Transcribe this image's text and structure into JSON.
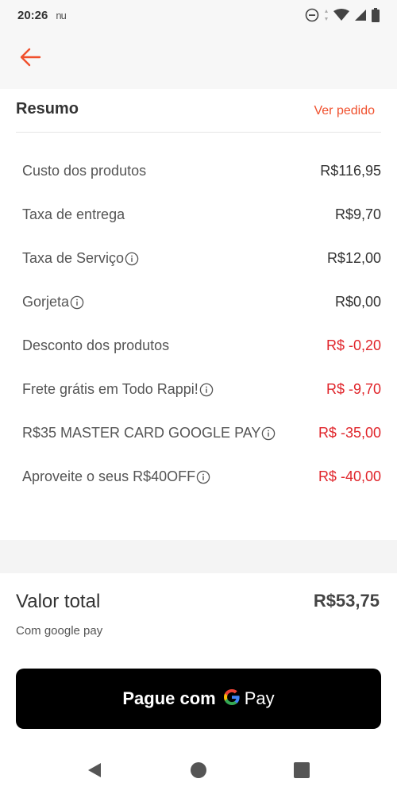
{
  "status_bar": {
    "time": "20:26",
    "app_indicator": "nu"
  },
  "icons": {
    "back": "arrow-left-icon",
    "info": "info-icon",
    "dnd": "do-not-disturb-icon",
    "wifi": "wifi-icon",
    "signal": "signal-icon",
    "battery": "battery-icon"
  },
  "colors": {
    "accent": "#f0502d",
    "negative": "#e0242a",
    "button_bg": "#000000"
  },
  "summary": {
    "title": "Resumo",
    "view_order": "Ver pedido"
  },
  "rows": [
    {
      "label": "Custo dos produtos",
      "value": "R$116,95",
      "info": false,
      "negative": false
    },
    {
      "label": "Taxa de entrega",
      "value": "R$9,70",
      "info": false,
      "negative": false
    },
    {
      "label": "Taxa de Serviço",
      "value": "R$12,00",
      "info": true,
      "negative": false
    },
    {
      "label": "Gorjeta",
      "value": "R$0,00",
      "info": true,
      "negative": false
    },
    {
      "label": "Desconto dos produtos",
      "value": "R$ -0,20",
      "info": false,
      "negative": true
    },
    {
      "label": "Frete grátis em Todo Rappi!",
      "value": "R$ -9,70",
      "info": true,
      "negative": true
    },
    {
      "label": "R$35 MASTER CARD GOOGLE PAY",
      "value": "R$ -35,00",
      "info": true,
      "negative": true
    },
    {
      "label": "Aproveite o seus R$40OFF",
      "value": "R$ -40,00",
      "info": true,
      "negative": true
    }
  ],
  "total": {
    "label": "Valor total",
    "value": "R$53,75",
    "method": "Com google pay"
  },
  "pay_button": {
    "label": "Pague com",
    "brand": "Pay"
  }
}
